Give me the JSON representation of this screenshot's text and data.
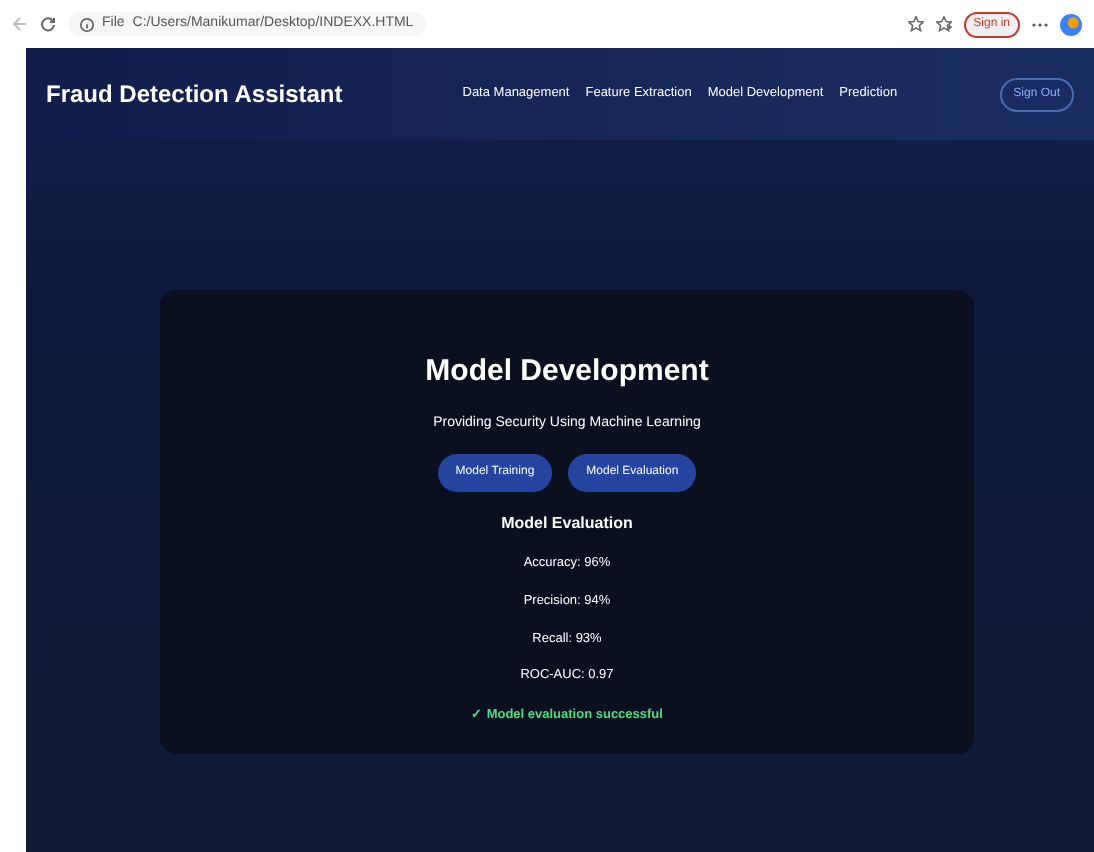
{
  "browser": {
    "address": "C:/Users/Manikumar/Desktop/INDEXX.HTML",
    "file_label": "File",
    "sign_in": "Sign in"
  },
  "navbar": {
    "brand": "Fraud Detection Assistant",
    "links": [
      {
        "label": "Data Management",
        "selected": false
      },
      {
        "label": "Feature Extraction",
        "selected": false
      },
      {
        "label": "Model Development",
        "selected": false
      },
      {
        "label": "Prediction",
        "selected": false
      }
    ],
    "sign_out": "Sign Out"
  },
  "card": {
    "title": "Model Development",
    "subtitle": "Providing Security Using Machine Learning",
    "buttons": [
      "Model Training",
      "Model Evaluation"
    ],
    "section_title": "Model Evaluation",
    "metrics": [
      "Accuracy: 96%",
      "Precision: 94%",
      "Recall: 93%",
      "ROC-AUC: 0.97"
    ],
    "status": {
      "icon": "✓",
      "text": "Model evaluation successful"
    }
  }
}
